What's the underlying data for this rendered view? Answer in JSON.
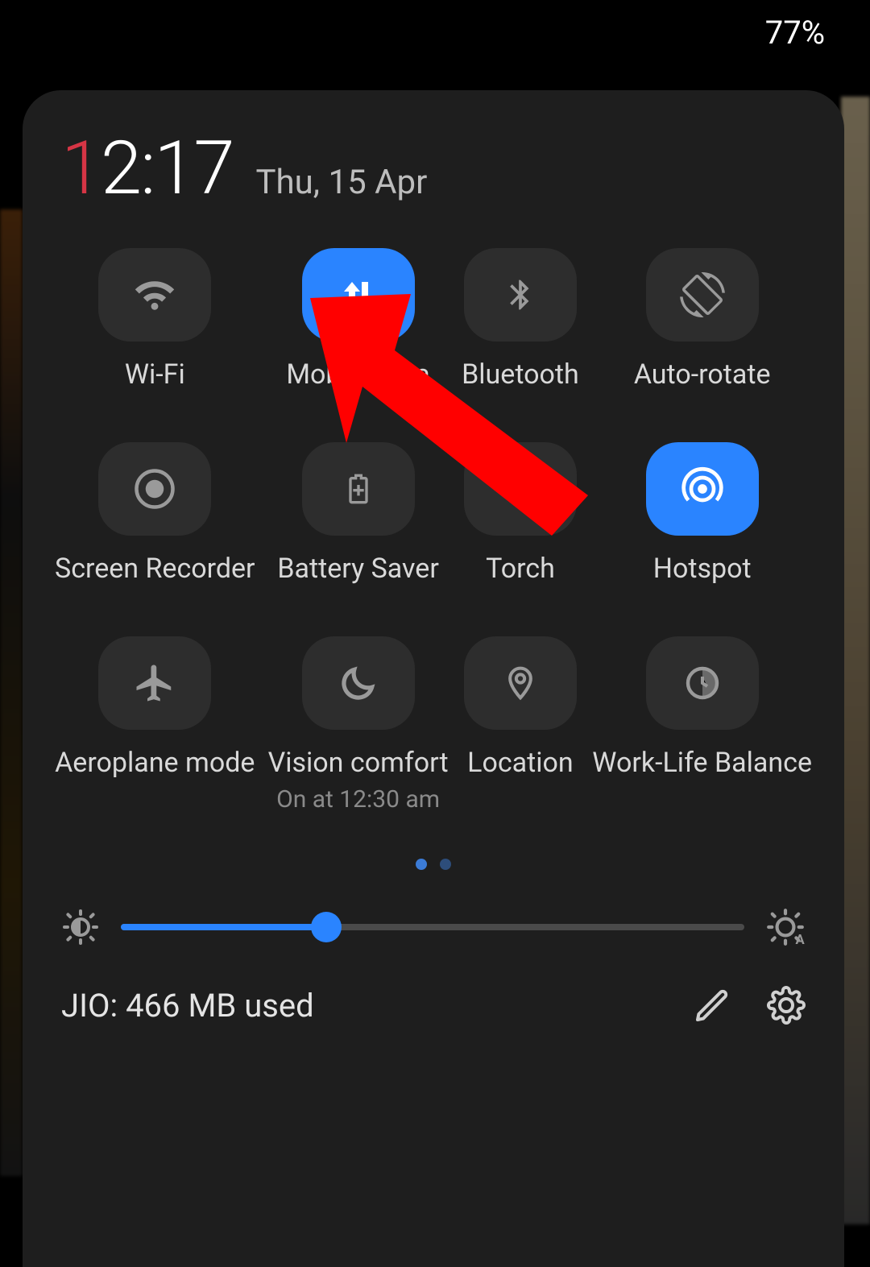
{
  "status": {
    "battery_percent": "77%"
  },
  "clock": {
    "hour1": "1",
    "rest": "2:17",
    "date": "Thu, 15 Apr"
  },
  "tiles": [
    {
      "id": "wifi",
      "label": "Wi-Fi",
      "active": false
    },
    {
      "id": "mobile-data",
      "label": "Mobile data",
      "active": true
    },
    {
      "id": "bluetooth",
      "label": "Bluetooth",
      "active": false
    },
    {
      "id": "auto-rotate",
      "label": "Auto-rotate",
      "active": false
    },
    {
      "id": "screen-recorder",
      "label": "Screen Recorder",
      "active": false
    },
    {
      "id": "battery-saver",
      "label": "Battery Saver",
      "active": false
    },
    {
      "id": "torch",
      "label": "Torch",
      "active": false
    },
    {
      "id": "hotspot",
      "label": "Hotspot",
      "active": true
    },
    {
      "id": "aeroplane",
      "label": "Aeroplane mode",
      "active": false
    },
    {
      "id": "vision-comfort",
      "label": "Vision comfort",
      "active": false,
      "sub": "On at 12:30 am"
    },
    {
      "id": "location",
      "label": "Location",
      "active": false
    },
    {
      "id": "work-life",
      "label": "Work-Life Balance",
      "active": false
    }
  ],
  "pager": {
    "current": 0,
    "total": 2
  },
  "brightness": {
    "percent": 33
  },
  "footer": {
    "text": "JIO: 466 MB used"
  },
  "colors": {
    "accent": "#2a84ff",
    "tile_off": "#2d2d2d",
    "clock_accent": "#d63545",
    "annotation_arrow": "#ff0000"
  }
}
